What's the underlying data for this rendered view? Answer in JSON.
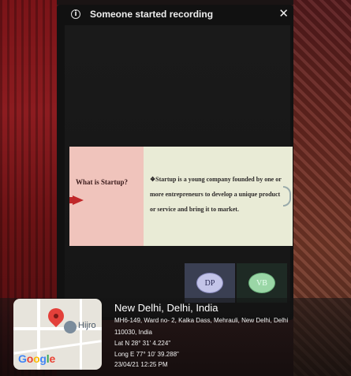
{
  "notification": {
    "text": "Someone started recording",
    "info_glyph": "i",
    "close_glyph": "✕"
  },
  "slide": {
    "title": "What is Startup?",
    "body": "❖Startup is a young company founded by one or more entrepreneurs to develop a unique product or service and bring it to market."
  },
  "participants": [
    {
      "initials": "DP"
    },
    {
      "initials": "VB"
    }
  ],
  "map": {
    "place_label": "Hijro",
    "logo_letters": [
      "G",
      "o",
      "o",
      "g",
      "l",
      "e"
    ]
  },
  "location": {
    "title": "New Delhi, Delhi, India",
    "address_line1": "MH6-149, Ward no- 2, Kalka Dass, Mehrauli, New Delhi, Delhi",
    "address_line2": "110030, India",
    "lat": "Lat N 28° 31' 4.224\"",
    "long": "Long E 77° 10' 39.288\"",
    "timestamp": "23/04/21 12:25 PM"
  },
  "colors": {
    "slide_left_bg": "#f0c4bc",
    "slide_right_bg": "#e9ebd6",
    "accent_arrow": "#c0282a",
    "avatar_dp": "#c3c4e8",
    "avatar_vb": "#9ad6a6",
    "map_pin": "#e3403a"
  },
  "icons": [
    "info-icon",
    "close-icon",
    "map-pin-icon",
    "place-icon",
    "google-logo"
  ]
}
